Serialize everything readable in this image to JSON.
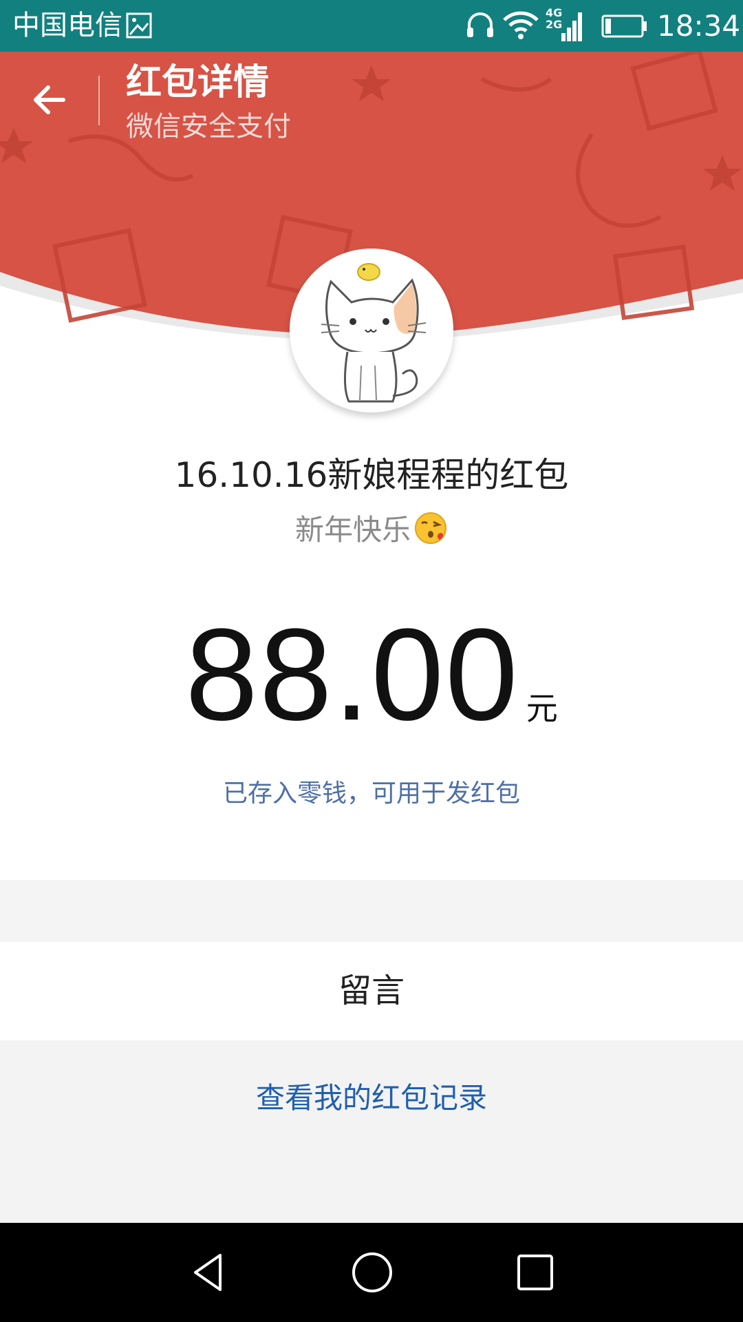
{
  "status_bar": {
    "carrier": "中国电信",
    "network": "4G",
    "network_secondary": "2G",
    "time": "18:34",
    "icons": [
      "gallery-icon",
      "headphone-icon",
      "wifi-icon",
      "signal-icon",
      "battery-icon"
    ]
  },
  "header": {
    "title": "红包详情",
    "subtitle": "微信安全支付",
    "accent_color": "#d65345"
  },
  "packet": {
    "sender_line": "16.10.16新娘程程的红包",
    "greeting": "新年快乐",
    "greeting_emoji": "kissing-face-emoji",
    "amount": "88.00",
    "unit": "元",
    "deposit_note": "已存入零钱，可用于发红包"
  },
  "message_row": {
    "label": "留言"
  },
  "records_link": {
    "label": "查看我的红包记录"
  },
  "nav_bar": {
    "icons": [
      "nav-back-icon",
      "nav-home-icon",
      "nav-recent-icon"
    ]
  }
}
